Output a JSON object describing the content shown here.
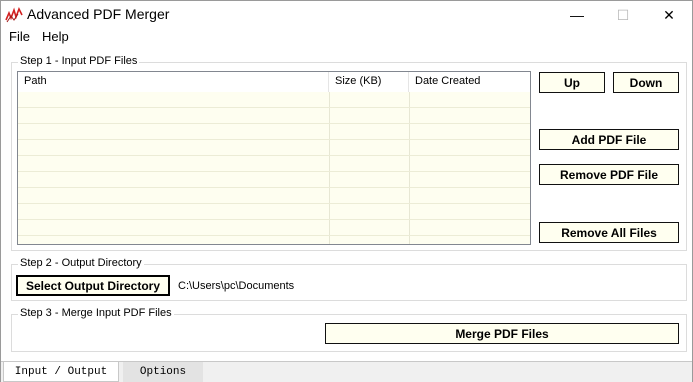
{
  "window": {
    "title": "Advanced PDF Merger",
    "controls": {
      "minimize": "—",
      "maximize": "☐",
      "close": "✕"
    }
  },
  "menu": {
    "file": "File",
    "help": "Help"
  },
  "step1": {
    "legend": "Step 1 - Input PDF Files",
    "columns": {
      "path": "Path",
      "size": "Size (KB)",
      "date": "Date Created"
    },
    "buttons": {
      "up": "Up",
      "down": "Down",
      "add": "Add PDF File",
      "remove": "Remove PDF File",
      "remove_all": "Remove All Files"
    }
  },
  "step2": {
    "legend": "Step 2 - Output Directory",
    "button": "Select Output Directory",
    "path": "C:\\Users\\pc\\Documents"
  },
  "step3": {
    "legend": "Step 3 - Merge Input PDF Files",
    "button": "Merge PDF Files"
  },
  "tabs": {
    "input_output": "Input / Output",
    "options": "Options"
  },
  "icons": {
    "app": "pdf-merger-app-icon"
  },
  "colors": {
    "list_background": "#fefef0",
    "button_background": "#fffff0",
    "icon_red": "#d22020"
  }
}
